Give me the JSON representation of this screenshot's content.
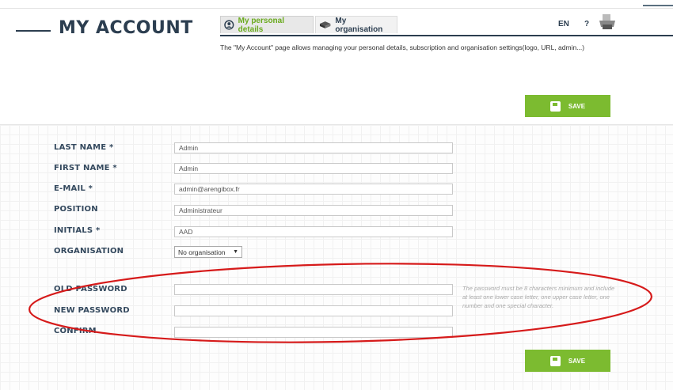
{
  "header": {
    "title": "MY ACCOUNT",
    "tabs": [
      {
        "label": "My personal details",
        "active": true,
        "icon": "user-icon"
      },
      {
        "label": "My organisation",
        "active": false,
        "icon": "box-icon"
      }
    ],
    "lang": "EN",
    "help": "?",
    "printer_icon": "printer-icon"
  },
  "description": "The \"My Account\" page allows managing your personal details, subscription and organisation settings(logo, URL, admin...)",
  "save_label": "SAVE",
  "accent_color": "#7cbb30",
  "title_color": "#2c3e50",
  "form": {
    "last_name": {
      "label": "LAST NAME *",
      "value": "Admin"
    },
    "first_name": {
      "label": "FIRST NAME *",
      "value": "Admin"
    },
    "email": {
      "label": "E-MAIL *",
      "value": "admin@arengibox.fr"
    },
    "position": {
      "label": "POSITION",
      "value": "Administrateur"
    },
    "initials": {
      "label": "INITIALS *",
      "value": "AAD"
    },
    "organisation": {
      "label": "ORGANISATION",
      "value": "No organisation"
    },
    "old_password": {
      "label": "OLD PASSWORD",
      "value": ""
    },
    "new_password": {
      "label": "NEW PASSWORD",
      "value": ""
    },
    "confirm": {
      "label": "CONFIRM",
      "value": ""
    }
  },
  "password_hint": "The password must be 8 characters minimum and include at least one lower case letter, one upper case letter, one number and one special character."
}
